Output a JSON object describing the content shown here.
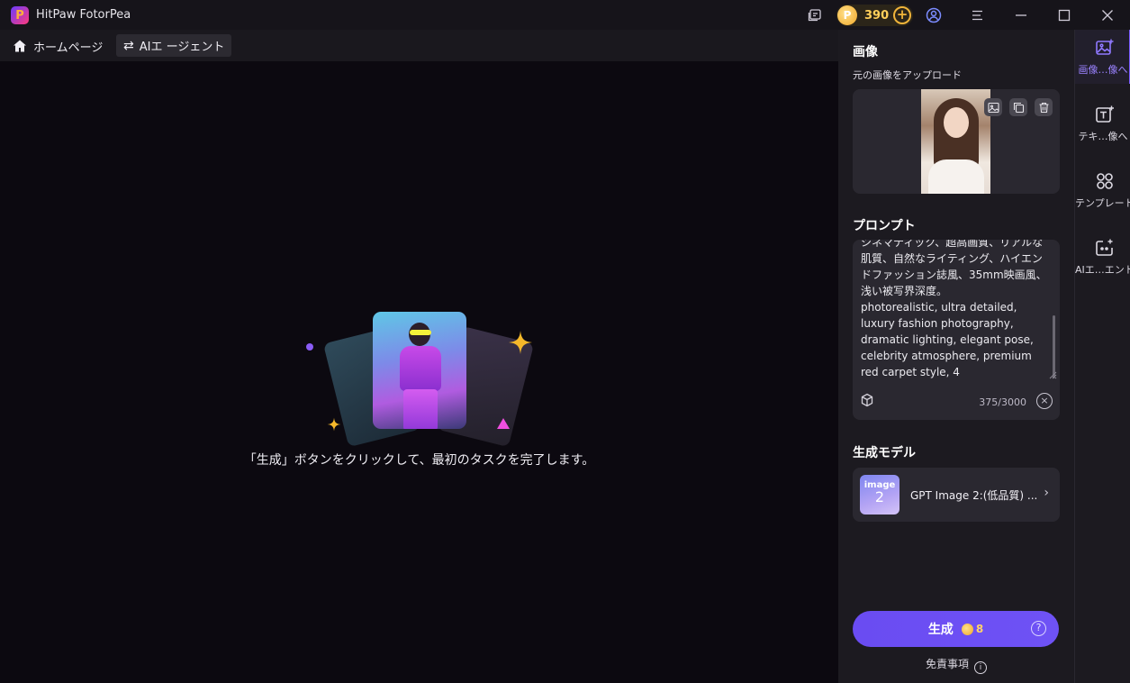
{
  "titlebar": {
    "app_name": "HitPaw FotorPea",
    "logo_letter": "P",
    "credits": "390"
  },
  "nav": {
    "home_label": "ホームページ",
    "agent_label": "AIエ ージェント"
  },
  "main": {
    "empty_message": "「生成」ボタンをクリックして、最初のタスクを完了します。"
  },
  "panel": {
    "image_section_title": "画像",
    "upload_label": "元の画像をアップロード",
    "prompt_section_title": "プロンプト",
    "prompt_text": "シネマティック、超高画質、リアルな肌質、自然なライティング、ハイエンドファッション誌風、35mm映画風、浅い被写界深度。\nphotorealistic, ultra detailed, luxury fashion photography, dramatic lighting, elegant pose, celebrity atmosphere, premium red carpet style, 4",
    "char_count": "375/3000",
    "model_section_title": "生成モデル",
    "model_thumb_line1": "image",
    "model_thumb_line2": "2",
    "model_name": "GPT Image 2:(低品質) ...",
    "generate_label": "生成",
    "generate_cost": "8",
    "disclaimer": "免責事項"
  },
  "rail": {
    "items": [
      {
        "label": "画像…像へ",
        "icon": "image-to-image-icon",
        "active": true
      },
      {
        "label": "テキ…像へ",
        "icon": "text-to-image-icon",
        "active": false
      },
      {
        "label": "テンプレート",
        "icon": "templates-icon",
        "active": false
      },
      {
        "label": "AIエ…エント",
        "icon": "ai-agent-icon",
        "active": false
      }
    ]
  },
  "colors": {
    "accent": "#6a4cf2",
    "coin": "#f0a727",
    "background": "#0c0910",
    "panel": "#1c1a20"
  }
}
